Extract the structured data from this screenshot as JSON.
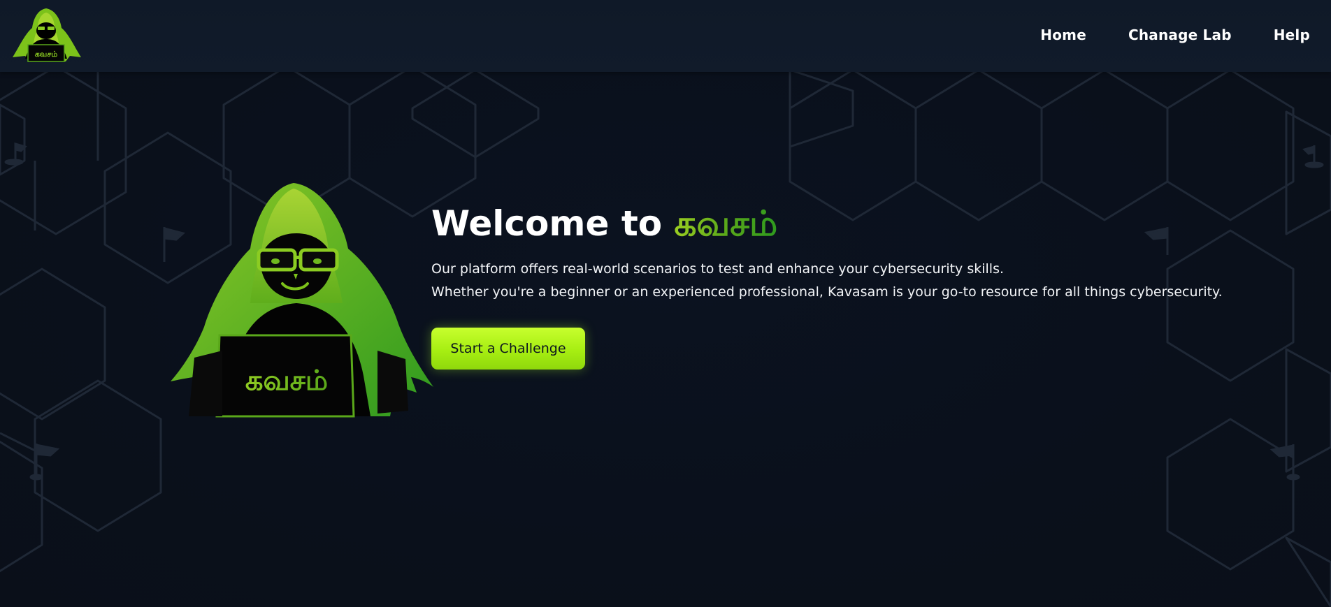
{
  "nav": {
    "logo_alt": "கவசம் logo",
    "links": [
      {
        "label": "Home"
      },
      {
        "label": "Chanage Lab"
      },
      {
        "label": "Help"
      }
    ]
  },
  "hero": {
    "title_prefix": "Welcome to ",
    "title_brand": "கவசம்",
    "description_line1": "Our platform offers real-world scenarios to test and enhance your cybersecurity skills.",
    "description_line2": "Whether you're a beginner or an experienced professional, Kavasam is your go-to resource for all things cybersecurity.",
    "cta_label": "Start a Challenge",
    "art_label": "கவசம்"
  },
  "icons": {
    "logo": "hooded-hacker-icon",
    "hero_art": "hooded-hacker-illustration",
    "background": "hexagon-flag-pattern"
  },
  "colors": {
    "background": "#0b111d",
    "navbar": "#111b2a",
    "accent_green": "#7cc21a",
    "button": "#a7ee12",
    "button_text": "#0d1520",
    "pattern_line": "#1e2735"
  }
}
